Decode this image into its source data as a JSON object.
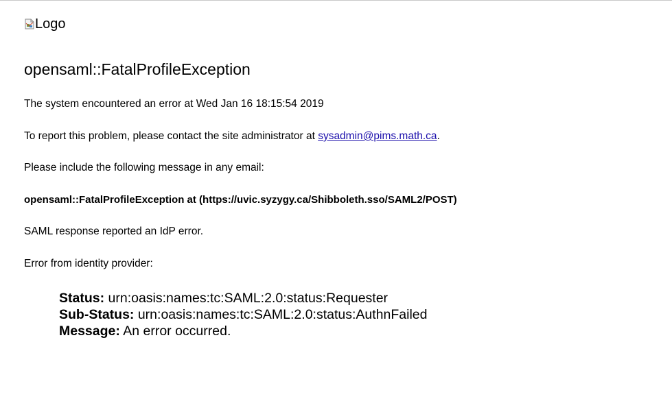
{
  "logo": {
    "alt_text": "Logo"
  },
  "error": {
    "title": "opensaml::FatalProfileException",
    "time_message": "The system encountered an error at Wed Jan 16 18:15:54 2019",
    "report_prefix": "To report this problem, please contact the site administrator at ",
    "admin_email": "sysadmin@pims.math.ca",
    "report_suffix": ".",
    "include_message": "Please include the following message in any email:",
    "exception_detail": "opensaml::FatalProfileException at (https://uvic.syzygy.ca/Shibboleth.sso/SAML2/POST)",
    "saml_message": "SAML response reported an IdP error.",
    "idp_message": "Error from identity provider:"
  },
  "status": {
    "status_label": "Status:",
    "status_value": " urn:oasis:names:tc:SAML:2.0:status:Requester",
    "substatus_label": "Sub-Status:",
    "substatus_value": " urn:oasis:names:tc:SAML:2.0:status:AuthnFailed",
    "message_label": "Message:",
    "message_value": " An error occurred."
  }
}
